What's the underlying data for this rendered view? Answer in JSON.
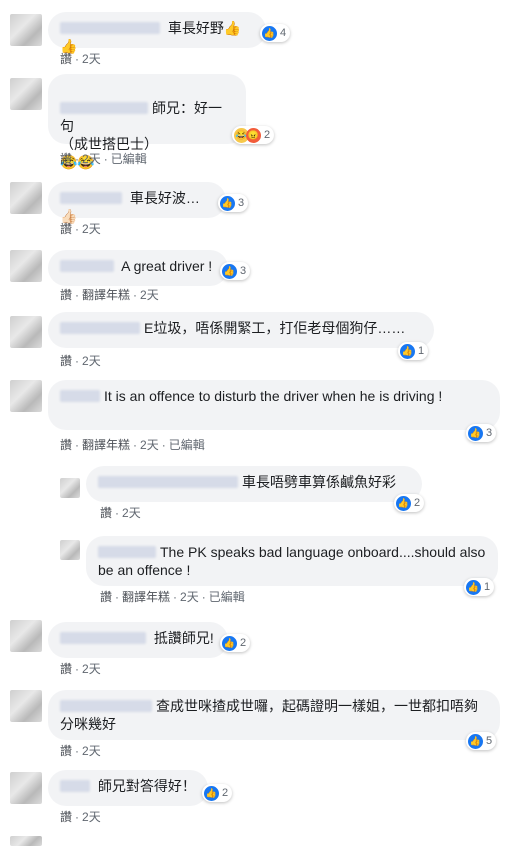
{
  "comments": [
    {
      "text": "車長好野👍👍",
      "count": "4",
      "meta": {
        "like": "讚",
        "time": "2天"
      }
    },
    {
      "text": "師兄：好一句\n（成世搭巴士）\n😂😂",
      "count": "2",
      "meta": {
        "like": "讚",
        "time": "2天",
        "edited": "已編輯"
      }
    },
    {
      "text": "車長好波…👍🏻",
      "count": "3",
      "meta": {
        "like": "讚",
        "time": "2天"
      }
    },
    {
      "text": "A great driver !",
      "count": "3",
      "meta": {
        "like": "讚",
        "translate": "翻譯年糕",
        "time": "2天"
      }
    },
    {
      "text": "E垃圾，唔係開緊工，打佢老母個狗仔……",
      "count": "1",
      "meta": {
        "like": "讚",
        "time": "2天"
      }
    },
    {
      "text": "It is an offence to disturb the driver when he is driving !",
      "count": "3",
      "meta": {
        "like": "讚",
        "translate": "翻譯年糕",
        "time": "2天",
        "edited": "已編輯"
      }
    },
    {
      "text": "車長唔劈車算係鹹魚好彩",
      "count": "2",
      "meta": {
        "like": "讚",
        "time": "2天"
      }
    },
    {
      "text": "The PK speaks bad language onboard....should also be an offence !",
      "count": "1",
      "meta": {
        "like": "讚",
        "translate": "翻譯年糕",
        "time": "2天",
        "edited": "已編輯"
      }
    },
    {
      "text": "抵讚師兄!",
      "count": "2",
      "meta": {
        "like": "讚",
        "time": "2天"
      }
    },
    {
      "text": "查成世咪揸成世囉，起碼證明一樣姐，一世都扣唔夠分咪幾好",
      "count": "5",
      "meta": {
        "like": "讚",
        "time": "2天"
      }
    },
    {
      "text": "師兄對答得好！",
      "count": "2",
      "meta": {
        "like": "讚",
        "time": "2天"
      }
    }
  ]
}
